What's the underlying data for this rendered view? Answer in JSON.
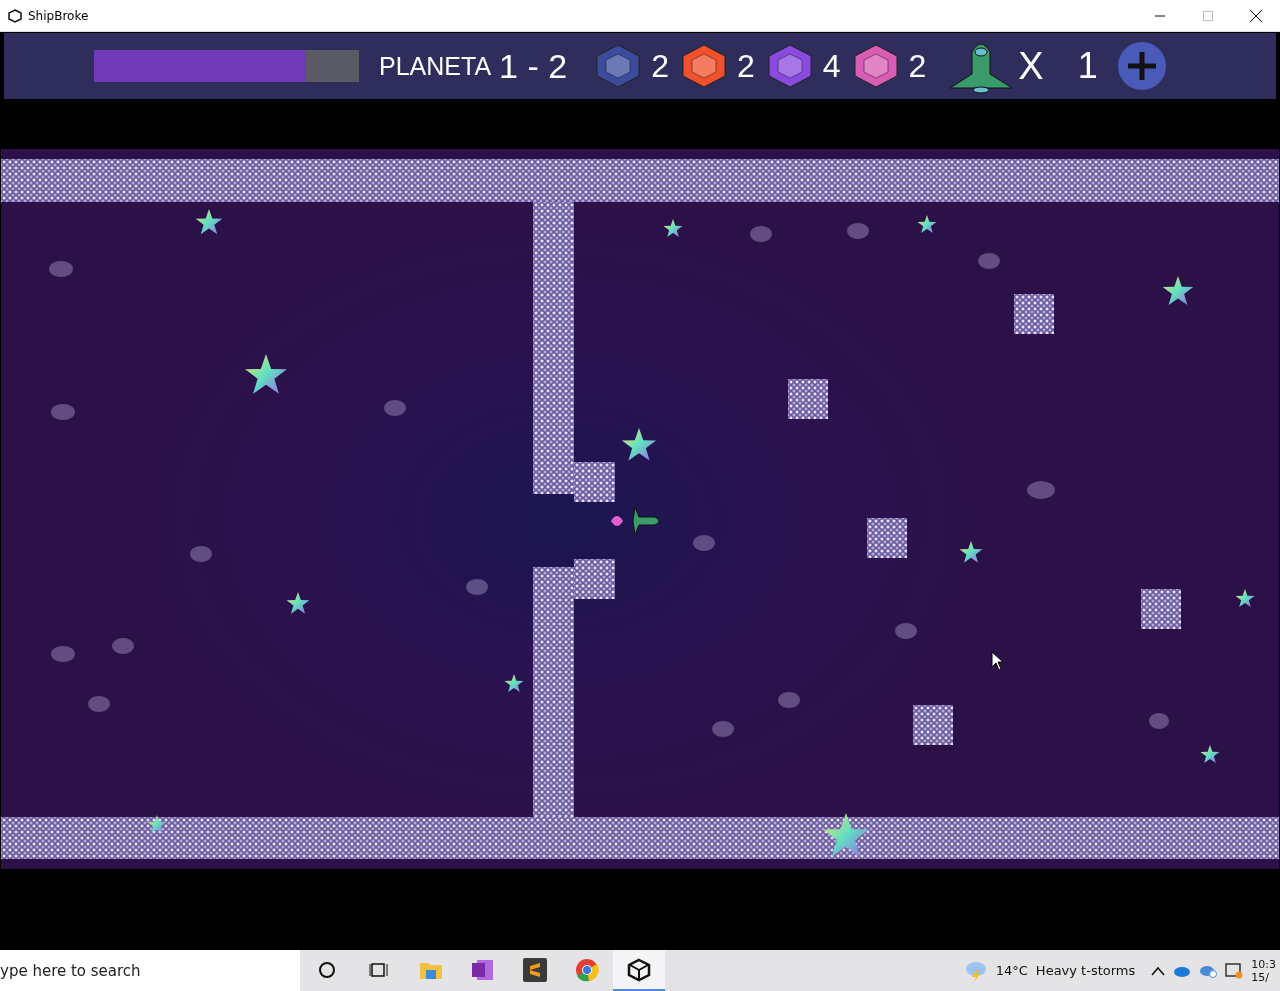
{
  "window": {
    "title": "ShipBroke"
  },
  "hud": {
    "health": {
      "level": 0.8
    },
    "level_label": "PLANETA",
    "level_number": "1 - 2",
    "gems": [
      {
        "color": "#3c4c9c",
        "count": "2"
      },
      {
        "color": "#f0502c",
        "count": "2"
      },
      {
        "color": "#8a4ae0",
        "count": "4"
      },
      {
        "color": "#d85cb4",
        "count": "2"
      }
    ],
    "lives": {
      "prefix": "X",
      "count": "1"
    }
  },
  "taskbar": {
    "search": {
      "placeholder": "ype here to search"
    },
    "apps": [
      {
        "kind": "cortana",
        "active": false
      },
      {
        "kind": "taskview",
        "active": false
      },
      {
        "kind": "explorer",
        "active": false
      },
      {
        "kind": "onenote",
        "active": false
      },
      {
        "kind": "sublime",
        "active": false
      },
      {
        "kind": "chrome",
        "active": false
      },
      {
        "kind": "unity",
        "active": true
      }
    ],
    "weather": {
      "temperature": "14°C",
      "condition": "Heavy t-storms"
    },
    "clock": {
      "time": "10:3",
      "date": "15/"
    }
  }
}
